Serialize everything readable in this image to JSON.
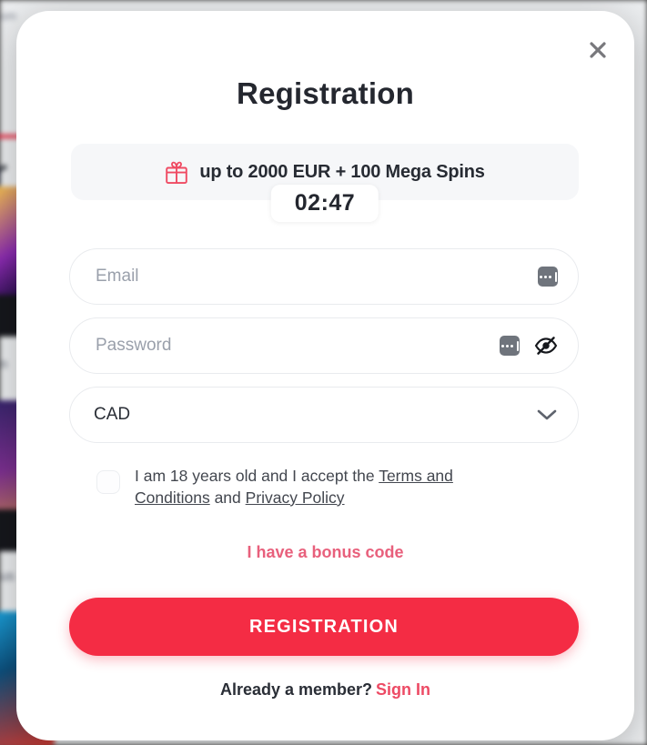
{
  "backdrop": {
    "page_heading": "r",
    "page_top_note": "om",
    "page_note_1": "n",
    "page_note_2": "us",
    "overlay_color": "#3d3d3d"
  },
  "modal": {
    "title": "Registration",
    "close_icon": "close-icon",
    "bonus": {
      "gift_icon": "gift-icon",
      "text": "up to 2000 EUR + 100 Mega Spins",
      "timer": "02:47",
      "banner_bg": "#f6f7f9"
    },
    "fields": {
      "email": {
        "placeholder": "Email",
        "value": "",
        "autofill_icon": "autofill-icon"
      },
      "password": {
        "placeholder": "Password",
        "value": "",
        "autofill_icon": "autofill-icon",
        "visibility_icon": "eye-off-icon"
      },
      "currency": {
        "value": "CAD",
        "chevron_icon": "chevron-down-icon",
        "options": [
          "CAD"
        ]
      }
    },
    "terms": {
      "checked": false,
      "text_before": "I am 18 years old and I accept the ",
      "terms_link": "Terms and Conditions",
      "text_between": " and ",
      "privacy_link": "Privacy Policy"
    },
    "bonus_code_link": "I have a bonus code",
    "submit_label": "REGISTRATION",
    "signin_prompt": "Already a member?",
    "signin_link": "Sign In",
    "accent_color": "#f42c44",
    "link_color": "#ed4a64"
  }
}
